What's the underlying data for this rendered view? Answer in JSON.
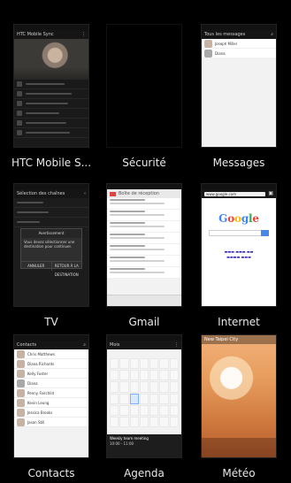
{
  "labels": {
    "htc": "HTC Mobile S...",
    "securite": "Sécurité",
    "messages": "Messages",
    "tv": "TV",
    "gmail": "Gmail",
    "internet": "Internet",
    "contacts": "Contacts",
    "agenda": "Agenda",
    "meteo": "Météo"
  },
  "thumbs": {
    "htc": {
      "title": "HTC Mobile Sync"
    },
    "messages": {
      "title": "Tous les messages",
      "items": [
        "Joseph Miller",
        "Diana"
      ]
    },
    "tv": {
      "title": "Sélection des chaînes",
      "dialog_title": "Avertissement",
      "dialog_text": "Vous devez sélectionner une destination pour continuer.",
      "btn_left": "ANNULER",
      "btn_right": "RETOUR À LA DESTINATION"
    },
    "gmail": {
      "header": "Boîte de réception"
    },
    "internet": {
      "url": "www.google.com"
    },
    "contacts": {
      "header": "Contacts",
      "names": [
        "Chris Matthews",
        "Diana Richards",
        "Kelly Foster",
        "Diana",
        "Penny Fairchild",
        "Kevin Leung",
        "Jessica Brooks",
        "Jason Still"
      ]
    },
    "agenda": {
      "header": "Mois",
      "event_title": "Weekly team meeting",
      "event_time": "10:00 - 11:00"
    },
    "meteo": {
      "header": "New Taipei City"
    }
  },
  "colors": {
    "background": "#000000",
    "label_text": "#e9e9e9",
    "gmail_accent": "#dd4444",
    "google_blue": "#4a86e8"
  }
}
